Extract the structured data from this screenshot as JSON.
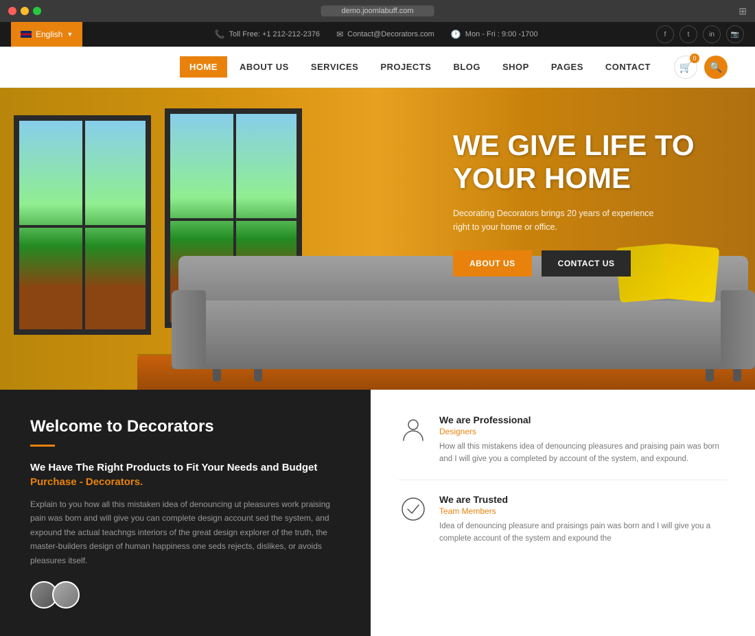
{
  "browser": {
    "url": "demo.joomlabuff.com",
    "dots": [
      "red",
      "yellow",
      "green"
    ]
  },
  "topbar": {
    "language": "English",
    "phone_icon": "📞",
    "phone": "Toll Free: +1 212-212-2376",
    "email_icon": "✉",
    "email": "Contact@Decorators.com",
    "clock_icon": "🕐",
    "hours": "Mon - Fri : 9:00 -1700",
    "social": [
      "f",
      "t",
      "in",
      "📷"
    ]
  },
  "nav": {
    "links": [
      "HOME",
      "ABOUT US",
      "SERVICES",
      "PROJECTS",
      "BLOG",
      "SHOP",
      "PAGES",
      "CONTACT"
    ],
    "active": "HOME",
    "cart_count": "0"
  },
  "hero": {
    "title_line1": "WE GIVE LIFE TO",
    "title_line2": "YOUR HOME",
    "subtitle": "Decorating Decorators brings 20 years of experience right to your home or office.",
    "btn_about": "ABOUT US",
    "btn_contact": "CONTACT US"
  },
  "about": {
    "section_title": "Welcome to Decorators",
    "subtitle_part1": "We Have The Right Products to Fit Your Needs and Budget ",
    "subtitle_link": "Purchase - Decorators.",
    "body_text": "Explain to you how all this mistaken idea of denouncing ut pleasures work praising pain was born and will give you can complete design account sed the system, and expound the actual teachngs interiors of the great design explorer of the truth, the master-builders design of human happiness one seds rejects, dislikes, or avoids pleasures itself.",
    "features": [
      {
        "icon": "person",
        "title": "We are Professional",
        "sub": "Designers",
        "desc": "How all this mistakens idea of denouncing pleasures and praising pain was born and I will give you a completed by account of the system, and expound."
      },
      {
        "icon": "check",
        "title": "We are Trusted",
        "sub": "Team Members",
        "desc": "Idea of denouncing pleasure and praisings pain was born and I will give you a complete account of the system and expound the"
      }
    ]
  }
}
